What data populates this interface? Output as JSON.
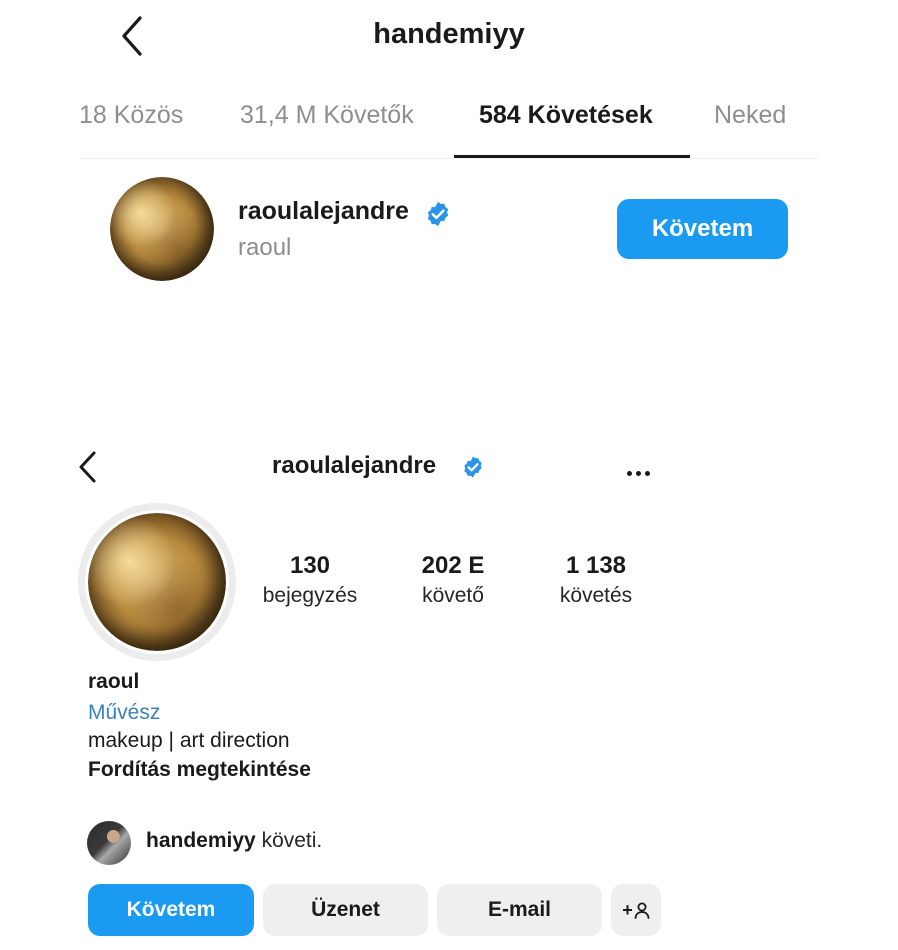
{
  "top": {
    "title": "handemiyy",
    "tabs": [
      {
        "label": "18 Közös"
      },
      {
        "label": "31,4 M Követők"
      },
      {
        "label": "584 Követések",
        "active": true
      },
      {
        "label": "Neked"
      }
    ],
    "row": {
      "username": "raoulalejandre",
      "fullname": "raoul",
      "verified": true,
      "button_label": "Követem"
    }
  },
  "profile": {
    "username": "raoulalejandre",
    "verified": true,
    "stats": [
      {
        "value": "130",
        "label": "bejegyzés"
      },
      {
        "value": "202 E",
        "label": "követő"
      },
      {
        "value": "1 138",
        "label": "követés"
      }
    ],
    "bio": {
      "name": "raoul",
      "category": "Művész",
      "text": "makeup | art direction",
      "translate_label": "Fordítás megtekintése"
    },
    "followed_by": {
      "username": "handemiyy",
      "suffix": "követi."
    },
    "buttons": {
      "follow": "Követem",
      "message": "Üzenet",
      "email": "E-mail",
      "add_person_icon": "+"
    }
  },
  "colors": {
    "accent": "#1a9af0",
    "verified": "#2a95e8",
    "category": "#3b82b8",
    "secondary_text": "#8e8e8e",
    "button_gray": "#efefef"
  }
}
